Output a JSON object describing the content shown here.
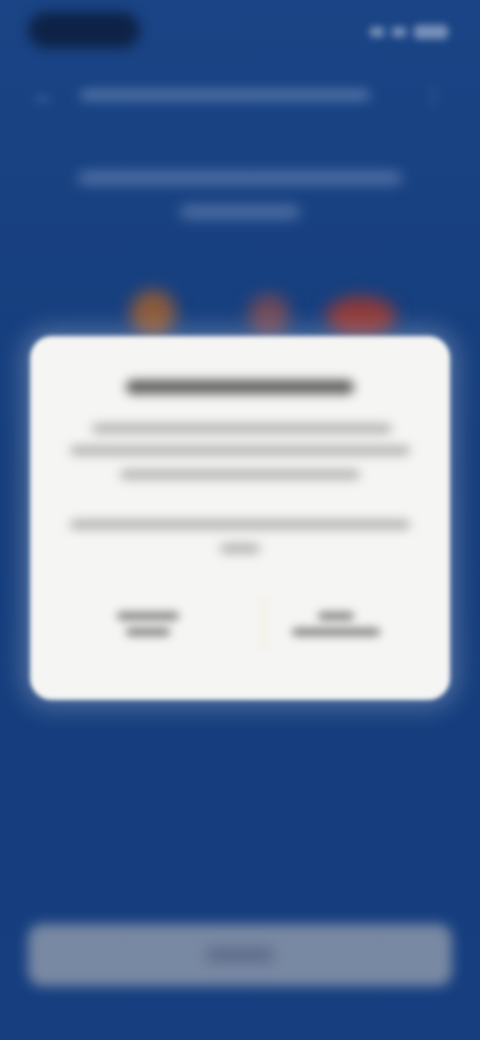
{
  "theme": {
    "background": "#173f7f",
    "dialog_background": "#f5f5f3",
    "bottom_button": "#8a96aa"
  },
  "status_bar": {
    "icons": [
      "signal-icon",
      "wifi-icon",
      "battery-icon"
    ]
  },
  "header": {
    "back_icon": "back-arrow-icon",
    "back_glyph": "←",
    "title": "",
    "menu_icon": "more-icon",
    "menu_glyph": "⋮"
  },
  "intro": {
    "text": ""
  },
  "dialog": {
    "title": "",
    "body": "",
    "note": "",
    "actions": [
      {
        "label": ""
      },
      {
        "label": ""
      }
    ]
  },
  "bottom_button": {
    "label": ""
  }
}
